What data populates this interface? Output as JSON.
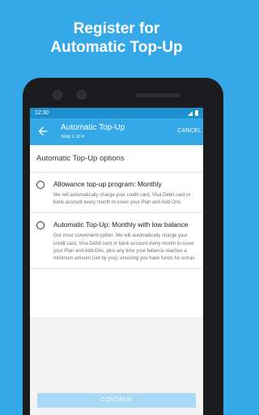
{
  "headline": {
    "line1": "Register for",
    "line2": "Automatic Top-Up"
  },
  "statusbar": {
    "time": "12:30",
    "icons": [
      "signal-icon",
      "battery-icon"
    ]
  },
  "appbar": {
    "title": "Automatic Top-Up",
    "step": "Step 1 of 4",
    "cancel_label": "CANCEL",
    "back_icon": "arrow-left-icon"
  },
  "section_title": "Automatic Top-Up options",
  "options": [
    {
      "title": "Allowance top-up program: Monthly",
      "description": "We will automatically charge your credit card, Visa Debit card or bank account every month to cover your Plan and Add-Ons.",
      "selected": false
    },
    {
      "title": "Automatic Top-Up: Monthly with low balance",
      "description": "Our most convenient option. We will automatically charge your credit card, Visa Debit card or bank account every month to cover your Plan and Add-Ons, plus any time your balance reaches a minimum amount (set by you), ensuring you have funds for extras.",
      "selected": false
    }
  ],
  "continue_label": "CONTINUE",
  "colors": {
    "brand": "#35a9e8",
    "statusbar": "#1e8fcd",
    "button_disabled": "#a8daf5"
  }
}
